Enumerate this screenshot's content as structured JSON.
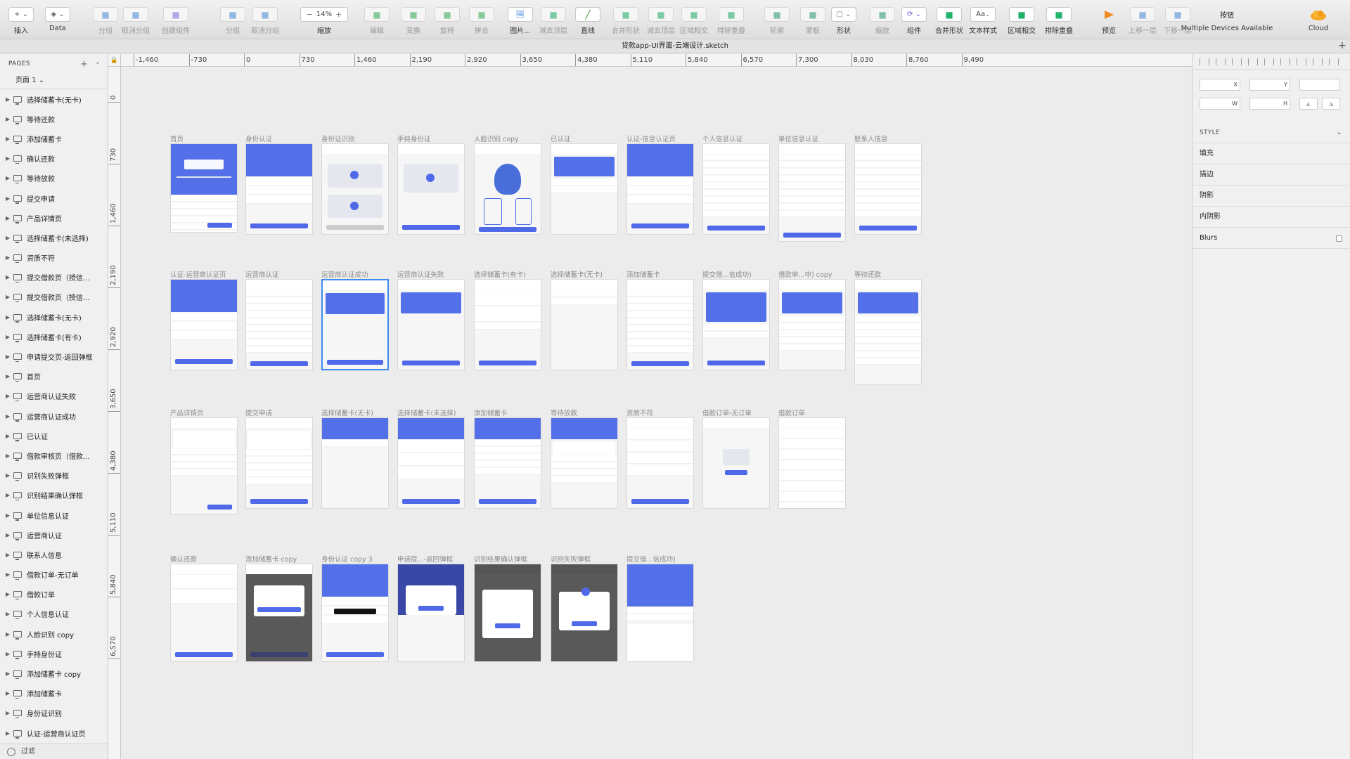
{
  "toolbar": [
    {
      "icon": "plus-icon",
      "label": "插入",
      "enabled": true
    },
    {
      "icon": "layers-icon",
      "label": "Data",
      "enabled": true
    },
    {
      "icon": "group-icon",
      "label": "分组",
      "enabled": false
    },
    {
      "icon": "ungroup-icon",
      "label": "取消分组",
      "enabled": false
    },
    {
      "icon": "create-symbol-icon",
      "label": "创建组件",
      "enabled": false
    },
    {
      "icon": "group-icon",
      "label": "分组",
      "enabled": false
    },
    {
      "icon": "ungroup-icon",
      "label": "取消分组",
      "enabled": false
    },
    {
      "icon": "zoom-icon",
      "label": "缩放",
      "enabled": true
    },
    {
      "icon": "edit-icon",
      "label": "编辑",
      "enabled": false
    },
    {
      "icon": "transform-icon",
      "label": "变换",
      "enabled": false
    },
    {
      "icon": "rotate-icon",
      "label": "旋转",
      "enabled": false
    },
    {
      "icon": "flatten-icon",
      "label": "拼合",
      "enabled": false
    },
    {
      "icon": "image-icon",
      "label": "图片...",
      "enabled": true
    },
    {
      "icon": "subtract-top-icon",
      "label": "减去顶层",
      "enabled": false
    },
    {
      "icon": "line-icon",
      "label": "直线",
      "enabled": true
    },
    {
      "icon": "union-icon",
      "label": "合并形状",
      "enabled": false
    },
    {
      "icon": "subtract-icon",
      "label": "减去顶层",
      "enabled": false
    },
    {
      "icon": "intersect-icon",
      "label": "区域相交",
      "enabled": false
    },
    {
      "icon": "difference-icon",
      "label": "排除重叠",
      "enabled": false
    },
    {
      "icon": "outline-icon",
      "label": "轮廓",
      "enabled": false
    },
    {
      "icon": "mask-icon",
      "label": "蒙板",
      "enabled": false
    },
    {
      "icon": "shape-icon",
      "label": "形状",
      "enabled": true
    },
    {
      "icon": "scale-icon",
      "label": "缩放",
      "enabled": false
    },
    {
      "icon": "symbol-icon",
      "label": "组件",
      "enabled": true
    },
    {
      "icon": "union-icon",
      "label": "合并形状",
      "enabled": true
    },
    {
      "icon": "text-style-icon",
      "label": "文本样式",
      "enabled": true
    },
    {
      "icon": "intersect-icon",
      "label": "区域相交",
      "enabled": true
    },
    {
      "icon": "difference-icon",
      "label": "排除重叠",
      "enabled": true
    },
    {
      "icon": "preview-icon",
      "label": "预览",
      "enabled": true
    },
    {
      "icon": "forward-icon",
      "label": "上移一层",
      "enabled": false
    },
    {
      "icon": "backward-icon",
      "label": "下移一层",
      "enabled": false
    },
    {
      "icon": "button-icon",
      "label": "Multiple Devices Available",
      "enabled": true
    },
    {
      "icon": "cloud-icon",
      "label": "Cloud",
      "enabled": true
    }
  ],
  "zoom_value": "14%",
  "button_label": "按钮",
  "text_style_glyph": "Aa",
  "document_title": "贷款app-UI界面-云端设计.sketch",
  "sidebar": {
    "pages_label": "PAGES",
    "current_page": "页面 1 ⌄",
    "filter_label": "过滤",
    "layers": [
      "选择储蓄卡(无卡)",
      "等待还款",
      "添加储蓄卡",
      "确认还款",
      "等待放款",
      "提交申请",
      "产品详情页",
      "选择储蓄卡(未选择)",
      "资质不符",
      "提交借款页（授信...",
      "提交借款页（授信...",
      "选择储蓄卡(无卡)",
      "选择储蓄卡(有卡)",
      "申请提交页-返回弹框",
      "首页",
      "运营商认证失败",
      "运营商认证成功",
      "已认证",
      "借款审核页（借款...",
      "识别失败弹框",
      "识别结果确认弹框",
      "单位信息认证",
      "运营商认证",
      "联系人信息",
      "借款订单-无订单",
      "借款订单",
      "个人信息认证",
      "人脸识别 copy",
      "手持身份证",
      "添加储蓄卡 copy",
      "添加储蓄卡",
      "身份证识别",
      "认证-运营商认证页"
    ]
  },
  "ruler": {
    "h_labels": [
      "-1,460",
      "-730",
      "0",
      "730",
      "1,460",
      "2,190",
      "2,920",
      "3,650",
      "4,380",
      "5,110",
      "5,840",
      "6,570",
      "7,300",
      "8,030",
      "8,760",
      "9,490"
    ],
    "v_labels": [
      "0",
      "730",
      "1,460",
      "2,190",
      "2,920",
      "3,650",
      "4,380",
      "5,110",
      "5,840",
      "6,570"
    ]
  },
  "artboards": [
    {
      "title": "首页",
      "kind": "home"
    },
    {
      "title": "身份认证",
      "kind": "idauth"
    },
    {
      "title": "身份证识别",
      "kind": "idscan"
    },
    {
      "title": "手持身份证",
      "kind": "handheld"
    },
    {
      "title": "人脸识别 copy",
      "kind": "face"
    },
    {
      "title": "已认证",
      "kind": "done"
    },
    {
      "title": "认证-信息认证页",
      "kind": "infoauth"
    },
    {
      "title": "个人信息认证",
      "kind": "form"
    },
    {
      "title": "单位信息认证",
      "kind": "form"
    },
    {
      "title": "联系人信息",
      "kind": "form"
    },
    {
      "title": "认证-运营商认证页",
      "kind": "idauth"
    },
    {
      "title": "运营商认证",
      "kind": "form"
    },
    {
      "title": "运营商认证成功",
      "kind": "success"
    },
    {
      "title": "运营商认证失败",
      "kind": "fail"
    },
    {
      "title": "选择储蓄卡(有卡)",
      "kind": "cards"
    },
    {
      "title": "选择储蓄卡(无卡)",
      "kind": "nocard"
    },
    {
      "title": "添加储蓄卡",
      "kind": "form"
    },
    {
      "title": "提交借...信成功)",
      "kind": "credit"
    },
    {
      "title": "借款审...中) copy",
      "kind": "review"
    },
    {
      "title": "等待还款",
      "kind": "repay"
    },
    {
      "title": "产品详情页",
      "kind": "product"
    },
    {
      "title": "提交申请",
      "kind": "apply"
    },
    {
      "title": "选择储蓄卡(无卡)",
      "kind": "nocard2"
    },
    {
      "title": "选择储蓄卡(未选择)",
      "kind": "cards2"
    },
    {
      "title": "添加储蓄卡",
      "kind": "addcard"
    },
    {
      "title": "等待放款",
      "kind": "wait"
    },
    {
      "title": "资质不符",
      "kind": "list"
    },
    {
      "title": "借款订单-无订单",
      "kind": "empty"
    },
    {
      "title": "借款订单",
      "kind": "orders"
    },
    {
      "title": "确认还款",
      "kind": "confirm"
    },
    {
      "title": "添加储蓄卡 copy",
      "kind": "dlg"
    },
    {
      "title": "身份认证 copy 3",
      "kind": "toast"
    },
    {
      "title": "申请提...-返回弹框",
      "kind": "dlgblue"
    },
    {
      "title": "识别结果确认弹框",
      "kind": "dlg2"
    },
    {
      "title": "识别失败弹框",
      "kind": "dlg3"
    },
    {
      "title": "提交借...信成功)",
      "kind": "keypad"
    }
  ],
  "inspector": {
    "x_label": "X",
    "y_label": "Y",
    "w_label": "W",
    "h_label": "H",
    "style_label": "STYLE",
    "sections": [
      "填充",
      "描边",
      "阴影",
      "内阴影",
      "Blurs"
    ]
  }
}
